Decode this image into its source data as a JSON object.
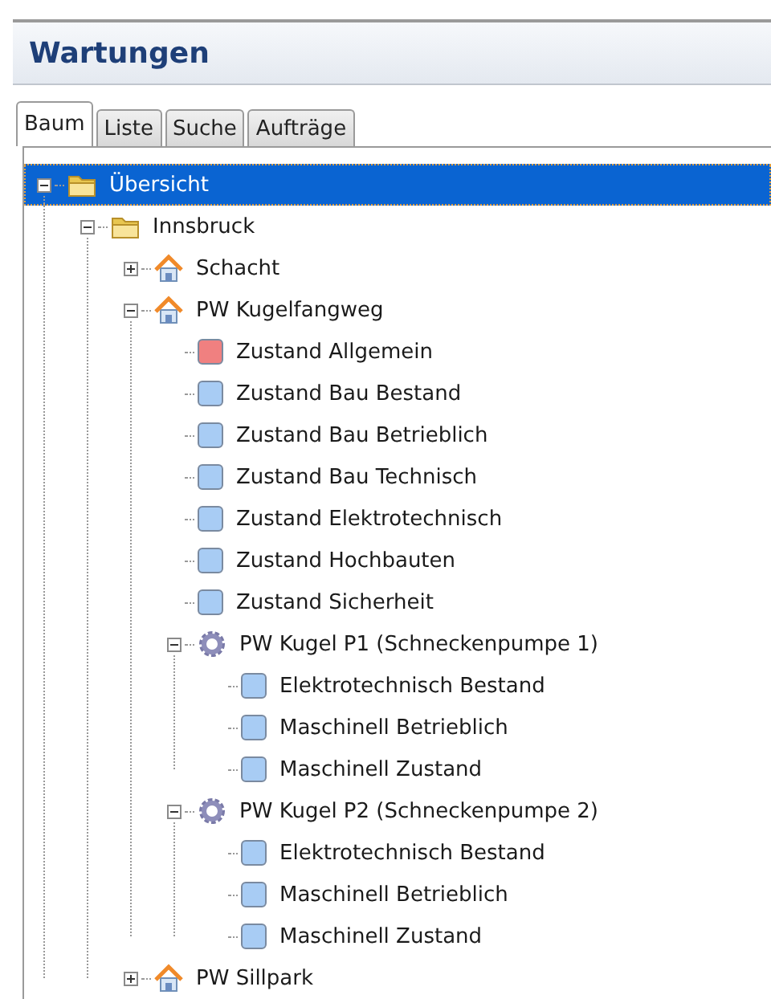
{
  "panel": {
    "title": "Wartungen"
  },
  "tabs": [
    {
      "label": "Baum",
      "selected": true
    },
    {
      "label": "Liste",
      "selected": false
    },
    {
      "label": "Suche",
      "selected": false
    },
    {
      "label": "Aufträge",
      "selected": false
    }
  ],
  "tree": [
    {
      "kind": "folder",
      "label": "Übersicht",
      "selected": true,
      "expanded": true,
      "children": [
        {
          "kind": "folder",
          "label": "Innsbruck",
          "selected": false,
          "expanded": true,
          "children": [
            {
              "kind": "house",
              "label": "Schacht",
              "selected": false,
              "expanded": false
            },
            {
              "kind": "house",
              "label": "PW Kugelfangweg",
              "selected": false,
              "expanded": true,
              "children": [
                {
                  "kind": "status",
                  "label": "Zustand Allgemein",
                  "selected": false,
                  "color": "#f08080"
                },
                {
                  "kind": "status",
                  "label": "Zustand Bau Bestand",
                  "selected": false,
                  "color": "#a8ccf4"
                },
                {
                  "kind": "status",
                  "label": "Zustand Bau Betrieblich",
                  "selected": false,
                  "color": "#a8ccf4"
                },
                {
                  "kind": "status",
                  "label": "Zustand Bau Technisch",
                  "selected": false,
                  "color": "#a8ccf4"
                },
                {
                  "kind": "status",
                  "label": "Zustand Elektrotechnisch",
                  "selected": false,
                  "color": "#a8ccf4"
                },
                {
                  "kind": "status",
                  "label": "Zustand Hochbauten",
                  "selected": false,
                  "color": "#a8ccf4"
                },
                {
                  "kind": "status",
                  "label": "Zustand Sicherheit",
                  "selected": false,
                  "color": "#a8ccf4"
                },
                {
                  "kind": "gear",
                  "label": "PW Kugel P1 (Schneckenpumpe 1)",
                  "selected": false,
                  "expanded": true,
                  "children": [
                    {
                      "kind": "status",
                      "label": "Elektrotechnisch Bestand",
                      "selected": false,
                      "color": "#a8ccf4"
                    },
                    {
                      "kind": "status",
                      "label": "Maschinell Betrieblich",
                      "selected": false,
                      "color": "#a8ccf4"
                    },
                    {
                      "kind": "status",
                      "label": "Maschinell Zustand",
                      "selected": false,
                      "color": "#a8ccf4"
                    }
                  ]
                },
                {
                  "kind": "gear",
                  "label": "PW Kugel P2 (Schneckenpumpe 2)",
                  "selected": false,
                  "expanded": true,
                  "children": [
                    {
                      "kind": "status",
                      "label": "Elektrotechnisch Bestand",
                      "selected": false,
                      "color": "#a8ccf4"
                    },
                    {
                      "kind": "status",
                      "label": "Maschinell Betrieblich",
                      "selected": false,
                      "color": "#a8ccf4"
                    },
                    {
                      "kind": "status",
                      "label": "Maschinell Zustand",
                      "selected": false,
                      "color": "#a8ccf4"
                    }
                  ]
                }
              ]
            },
            {
              "kind": "house",
              "label": "PW Sillpark",
              "selected": false,
              "expanded": false
            }
          ]
        }
      ]
    }
  ]
}
